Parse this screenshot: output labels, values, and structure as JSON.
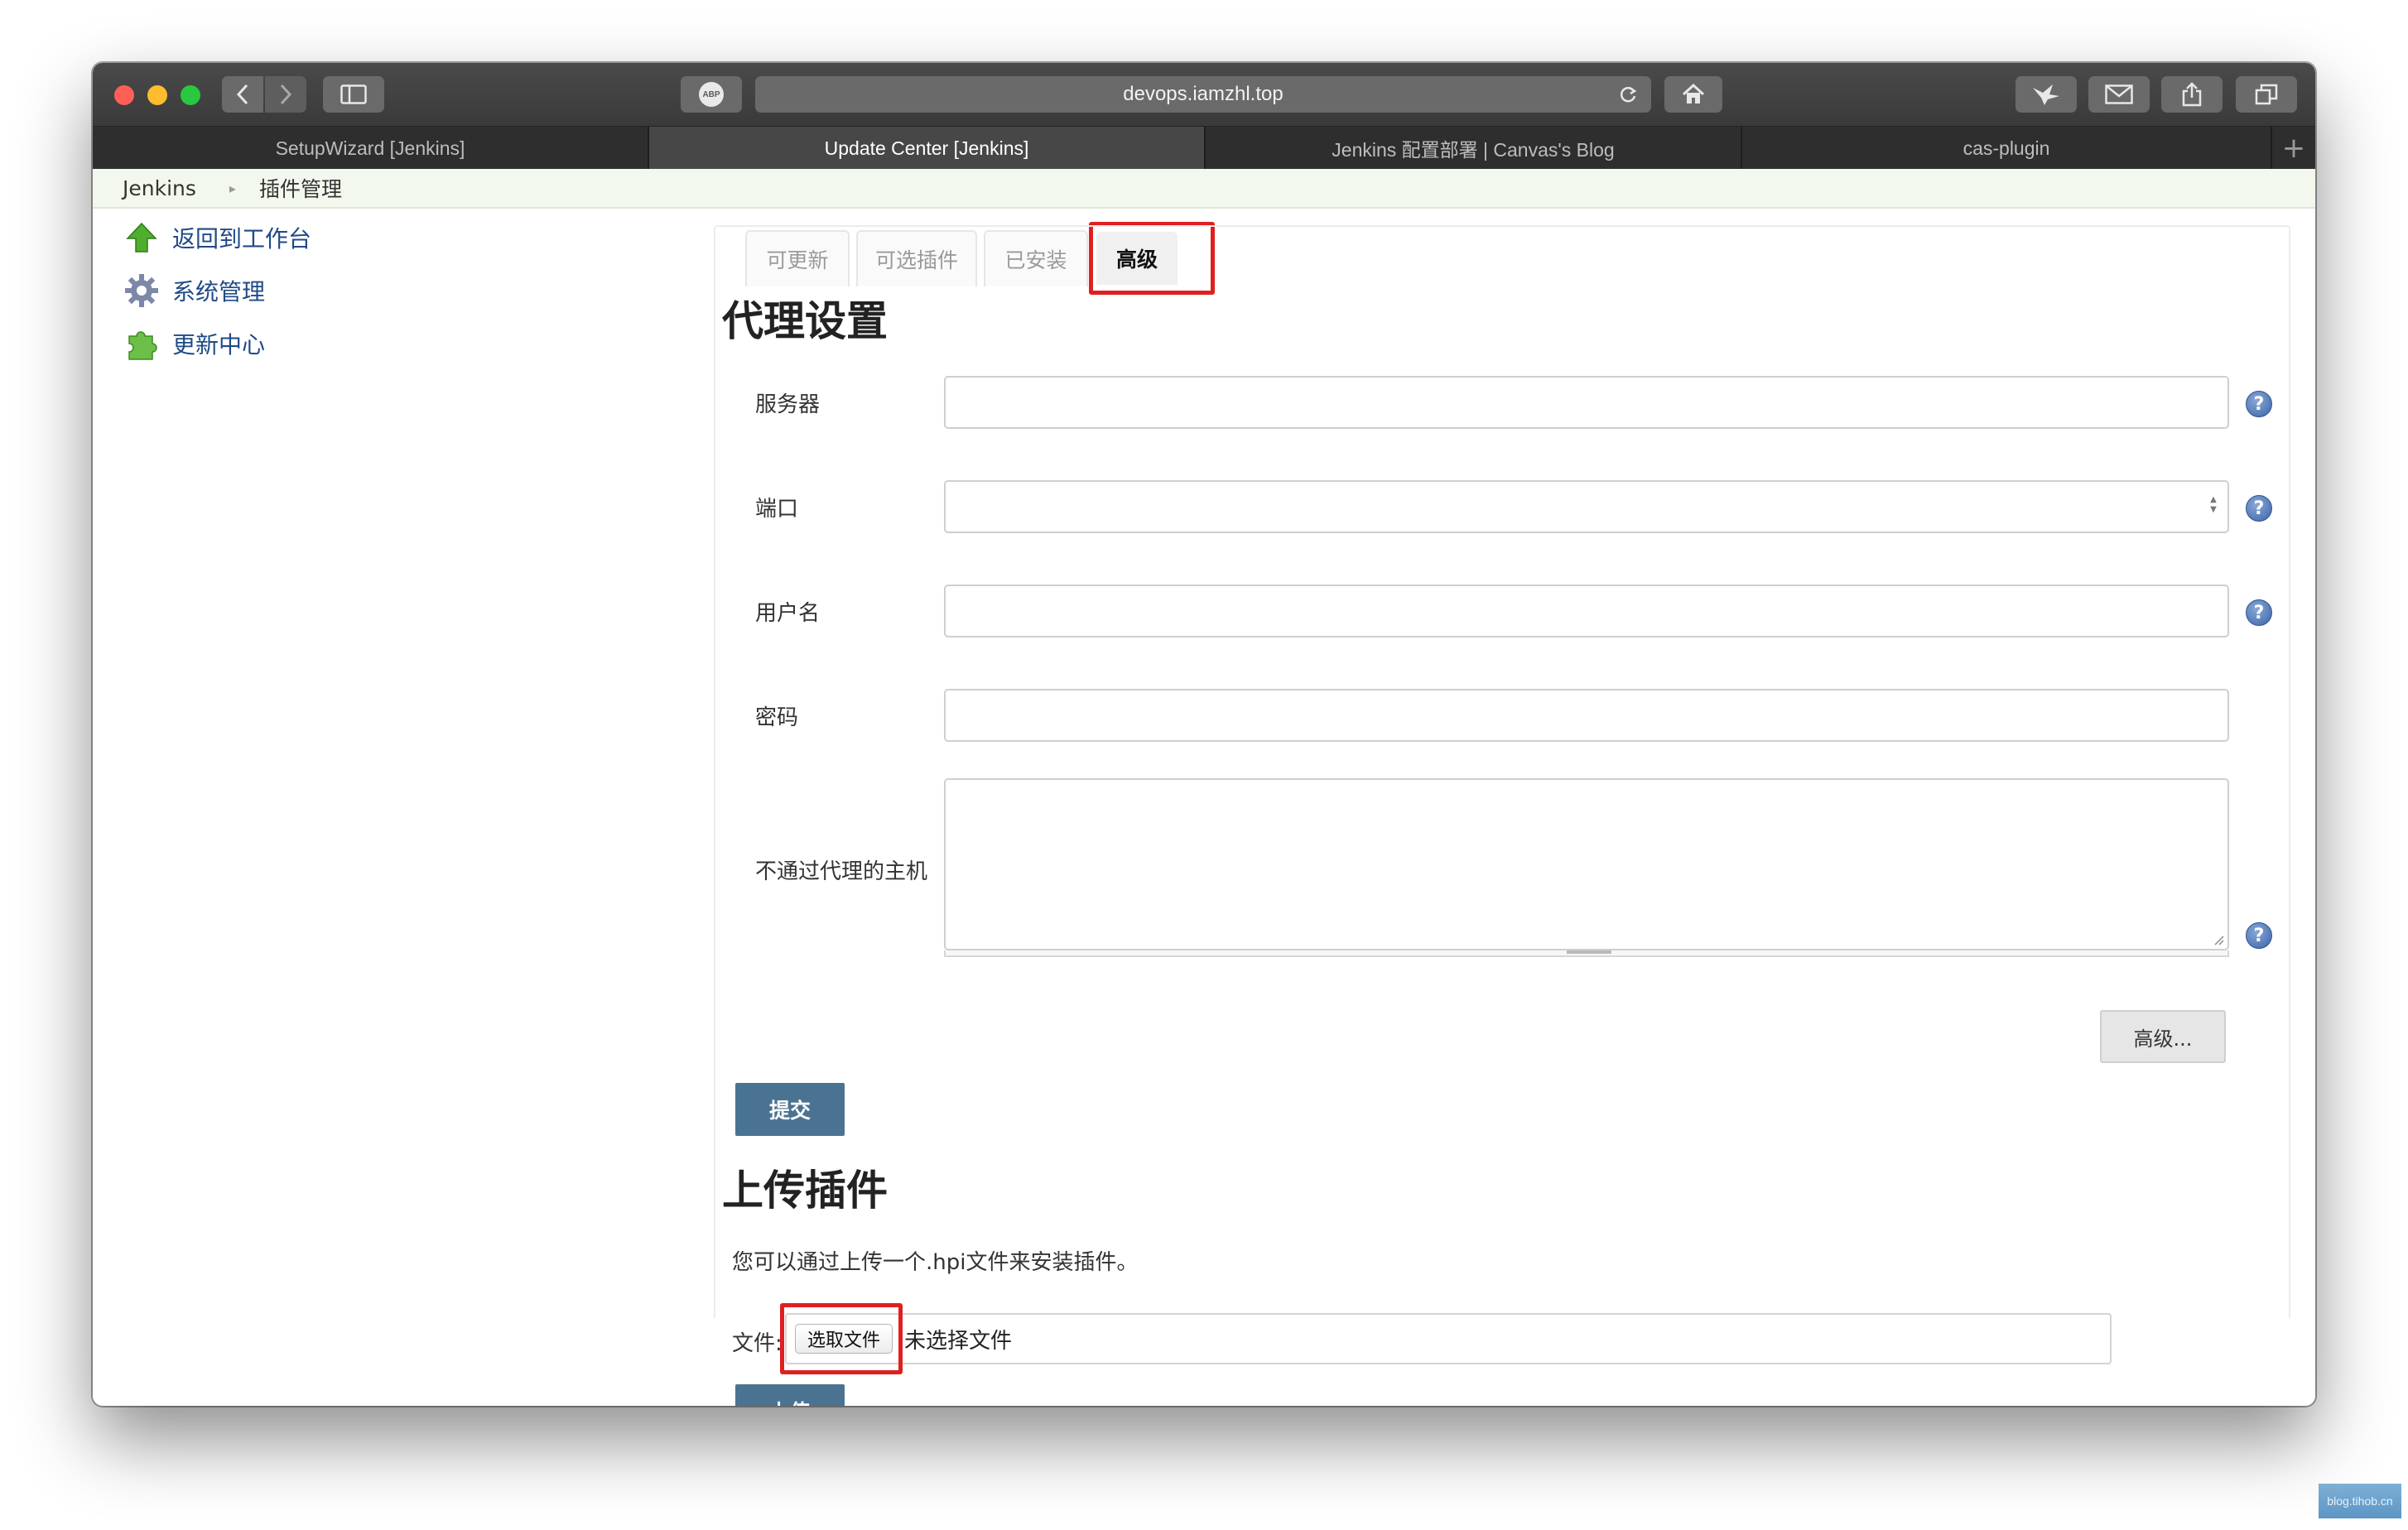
{
  "browser": {
    "url": "devops.iamzhl.top",
    "tabs": [
      {
        "label": "SetupWizard [Jenkins]",
        "active": false
      },
      {
        "label": "Update Center [Jenkins]",
        "active": true
      },
      {
        "label": "Jenkins 配置部署 | Canvas's Blog",
        "active": false
      },
      {
        "label": "cas-plugin",
        "active": false
      }
    ],
    "abp_label": "ABP",
    "new_tab_symbol": "+"
  },
  "breadcrumb": {
    "root": "Jenkins",
    "current": "插件管理"
  },
  "sidebar": {
    "items": [
      {
        "label": "返回到工作台",
        "icon": "up-arrow-icon"
      },
      {
        "label": "系统管理",
        "icon": "gear-icon"
      },
      {
        "label": "更新中心",
        "icon": "puzzle-icon"
      }
    ]
  },
  "plugin_tabs": [
    {
      "label": "可更新",
      "selected": false
    },
    {
      "label": "可选插件",
      "selected": false
    },
    {
      "label": "已安装",
      "selected": false
    },
    {
      "label": "高级",
      "selected": true
    }
  ],
  "proxy": {
    "title": "代理设置",
    "fields": [
      {
        "label": "服务器",
        "value": ""
      },
      {
        "label": "端口",
        "value": ""
      },
      {
        "label": "用户名",
        "value": ""
      },
      {
        "label": "密码",
        "value": ""
      },
      {
        "label": "不通过代理的主机",
        "value": ""
      }
    ],
    "help_symbol": "?",
    "advanced_button": "高级...",
    "submit_button": "提交"
  },
  "upload": {
    "title": "上传插件",
    "description": "您可以通过上传一个.hpi文件来安装插件。",
    "file_label": "文件:",
    "choose_button": "选取文件",
    "no_file_text": "未选择文件",
    "upload_button": "上传"
  },
  "watermark": "blog.tihob.cn",
  "colors": {
    "accent_button": "#4a7391",
    "highlight_box": "#e01f1f",
    "link": "#204a87",
    "breadcrumb_bg": "#f3f8ee"
  }
}
